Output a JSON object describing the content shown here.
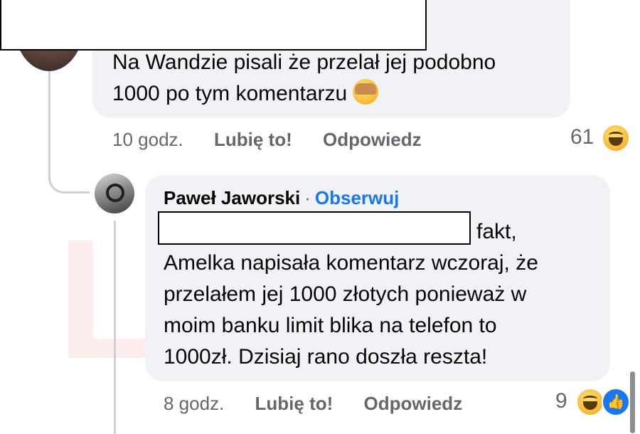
{
  "watermark": "LUBA",
  "comment1": {
    "lines": [
      "Na Wandzie pisali że przelał jej podobno",
      "1000 po tym komentarzu"
    ],
    "emoji": "see-no-evil-monkey",
    "time": "10 godz.",
    "like_label": "Lubię to!",
    "reply_label": "Odpowiedz",
    "reaction_count": "61",
    "reactions": [
      "haha"
    ]
  },
  "comment2": {
    "author": "Paweł Jaworski",
    "separator": "·",
    "follow_label": "Obserwuj",
    "lines": [
      "fakt,",
      "Amelka napisała komentarz wczoraj, że",
      "przelałem jej 1000 złotych ponieważ w",
      "moim banku limit blika na telefon to",
      "1000zł. Dzisiaj rano doszła reszta!"
    ],
    "time": "8 godz.",
    "like_label": "Lubię to!",
    "reply_label": "Odpowiedz",
    "reaction_count": "9",
    "reactions": [
      "haha",
      "like"
    ]
  },
  "colors": {
    "bubble": "#f0f2f5",
    "meta_text": "#65676b",
    "follow": "#1877f2",
    "watermark": "#f04646"
  }
}
